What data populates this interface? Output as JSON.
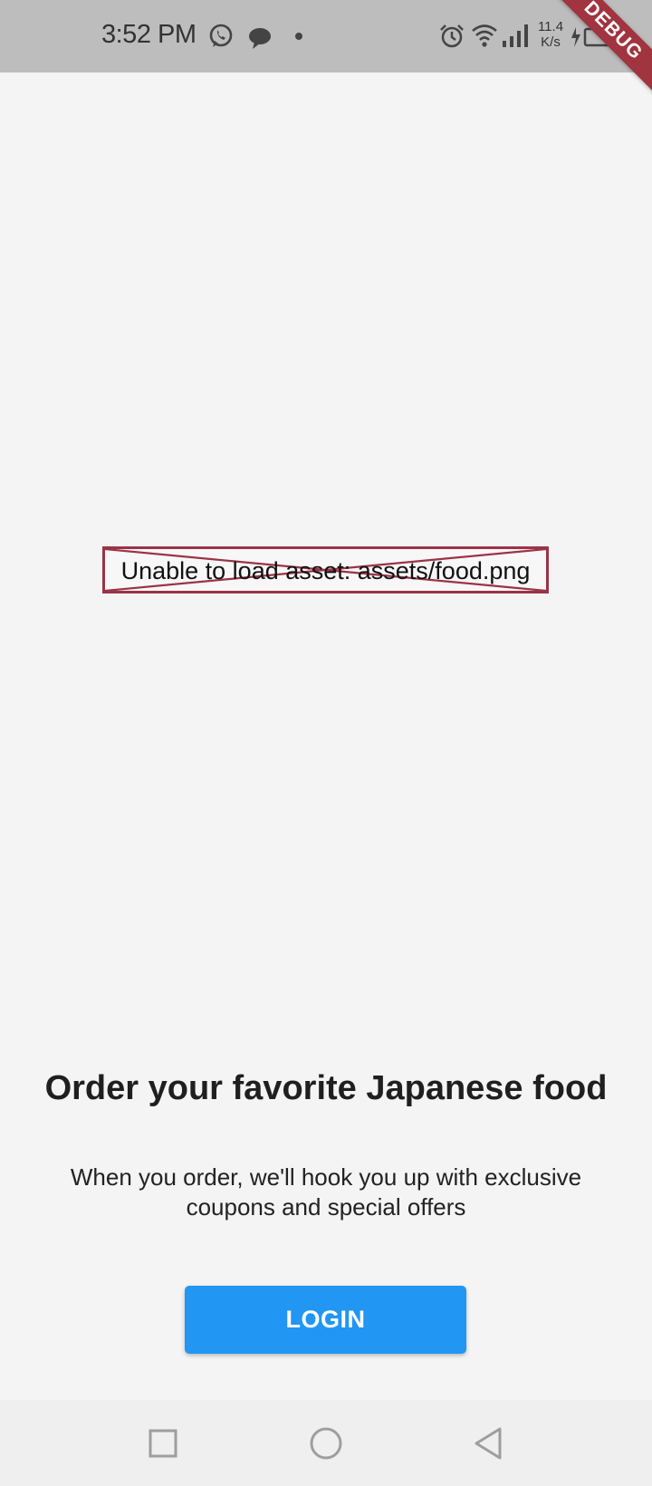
{
  "status_bar": {
    "time": "3:52 PM",
    "net_speed_value": "11.4",
    "net_speed_unit": "K/s",
    "icons": [
      "whatsapp-icon",
      "chat-bubble-icon",
      "notification-dot-icon",
      "alarm-icon",
      "wifi-icon",
      "signal-icon",
      "battery-charging-icon"
    ]
  },
  "debug_banner": {
    "label": "DEBUG",
    "color": "#a0343f"
  },
  "hero_image": {
    "error_text": "Unable to load asset: assets/food.png",
    "border_color": "#9b3346"
  },
  "onboarding": {
    "title": "Order your favorite Japanese food",
    "description": "When you order, we'll hook you up with exclusive coupons and special offers",
    "login_label": "LOGIN"
  },
  "colors": {
    "accent": "#2196f3",
    "background": "#f4f4f4",
    "status_bar": "#bdbdbd",
    "nav_bar": "#efefef"
  },
  "nav_bar": {
    "buttons": [
      "recents-square-icon",
      "home-circle-icon",
      "back-triangle-icon"
    ]
  }
}
